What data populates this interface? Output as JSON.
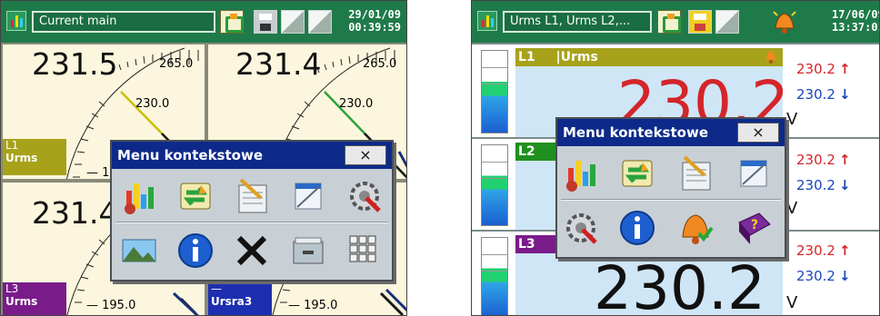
{
  "colors": {
    "topbar": "#1f7a4a",
    "gauge_background": "#fbf6dd",
    "value_red": "#d4252a",
    "value_blue": "#1c46b8",
    "menu_title": "#0d2a8a",
    "l1_band": "#a7a21a",
    "l2_band": "#1f8f1f",
    "l3_band": "#7a1b8a",
    "ursra3_band": "#1d2fb0"
  },
  "left": {
    "title": "Current main",
    "date": "29/01/09",
    "time": "00:39:59",
    "gauges": [
      {
        "value": "231.5",
        "max_label": "265.0",
        "mid_label": "230.0",
        "min_label": "195.0"
      },
      {
        "value": "231.4",
        "max_label": "265.0",
        "mid_label": "230.0"
      },
      {
        "value": "231.4",
        "min_label": "195.0"
      },
      {
        "value": "",
        "min_label": "195.0"
      }
    ],
    "channels": [
      {
        "name": "L1",
        "param": "Urms"
      },
      {
        "name": "L3",
        "param": "Urms"
      },
      {
        "name": "",
        "param": "Ursra3"
      }
    ],
    "menu": {
      "title": "Menu kontekstowe",
      "close": "×",
      "icons": [
        "chart-icon",
        "refresh-icon",
        "notepad-icon",
        "window-icon",
        "settings-icon",
        "landscape-icon",
        "info-icon",
        "delete-icon",
        "drawer-icon",
        "keyboard-icon"
      ]
    }
  },
  "right": {
    "title": "Urms L1, Urms L2,...",
    "date": "17/06/09",
    "time": "13:37:01",
    "unit": "V",
    "rows": [
      {
        "label": "L1",
        "param": "|Urms",
        "value": "230.2",
        "value_color": "red",
        "max": "230.2",
        "min": "230.2"
      },
      {
        "label": "L2",
        "param": "",
        "value": "",
        "max": "230.2",
        "min": "230.2"
      },
      {
        "label": "L3",
        "param": "",
        "value": "230.2",
        "value_color": "black",
        "max": "230.2",
        "min": "230.2"
      }
    ],
    "arrows": {
      "up": "↑",
      "down": "↓"
    },
    "menu": {
      "title": "Menu kontekstowe",
      "close": "×",
      "icons": [
        "chart-icon",
        "refresh-icon",
        "notepad-icon",
        "window-icon",
        "settings-icon",
        "info-icon",
        "alarm-bell-icon",
        "help-book-icon"
      ]
    }
  }
}
